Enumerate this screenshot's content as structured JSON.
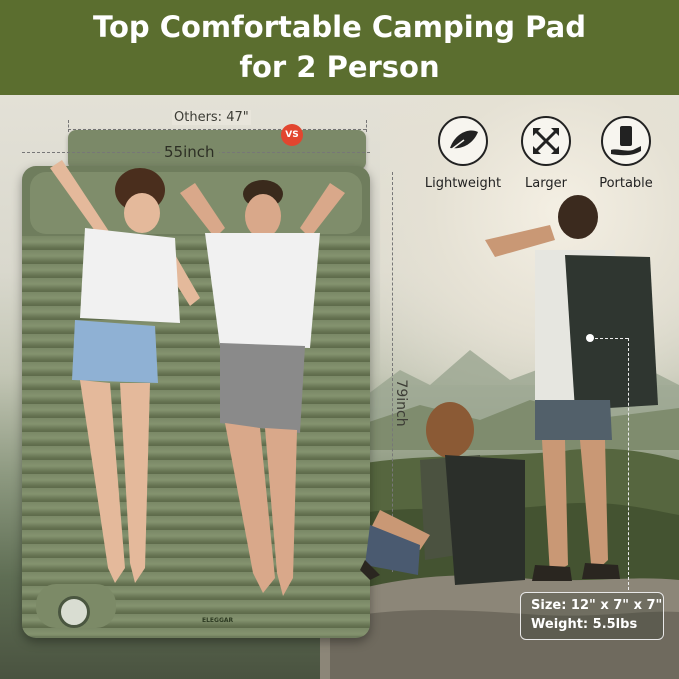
{
  "title": {
    "line1": "Top Comfortable Camping Pad",
    "line2": "for 2 Person"
  },
  "dimensions": {
    "others": "Others: 47\"",
    "vs": "VS",
    "width": "55inch",
    "length": "79inch"
  },
  "pad": {
    "brand": "ELEGGAR"
  },
  "features": [
    {
      "label": "Lightweight",
      "icon": "feather-icon"
    },
    {
      "label": "Larger",
      "icon": "expand-arrows-icon"
    },
    {
      "label": "Portable",
      "icon": "hand-holding-bag-icon"
    }
  ],
  "specs": {
    "size": "Size: 12\" x 7\" x 7\"",
    "weight": "Weight: 5.5lbs"
  },
  "colors": {
    "banner": "#5b6e2f",
    "pad": "#6f7d5d",
    "vs_badge": "#e2462f"
  }
}
